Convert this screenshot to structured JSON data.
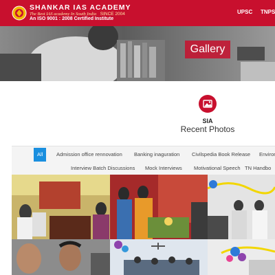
{
  "header": {
    "brand_name": "SHANKAR IAS ACADEMY",
    "tagline": "The Best IAS academy In South India",
    "since": "SINCE 2004",
    "iso": "An ISO 9001 : 2008 Certified Institute",
    "nav": [
      "UPSC",
      "TNPSC"
    ]
  },
  "hero": {
    "title": "Gallery"
  },
  "section": {
    "label": "SIA",
    "title": "Recent Photos"
  },
  "filters": {
    "row1": [
      "All",
      "Admission office rennovation",
      "Banking inaguration",
      "Civilspedia Book Release",
      "Enviror"
    ],
    "row2": [
      "Interview Batch Discussions",
      "Mock Interviews",
      "Motivational Speech",
      "TN Handbo"
    ],
    "active": "All"
  },
  "colors": {
    "brand_red": "#c8102e",
    "active_filter": "#1a8fdf"
  },
  "icons": {
    "gallery_badge": "photo-gallery-icon",
    "logo": "academy-emblem-icon"
  }
}
